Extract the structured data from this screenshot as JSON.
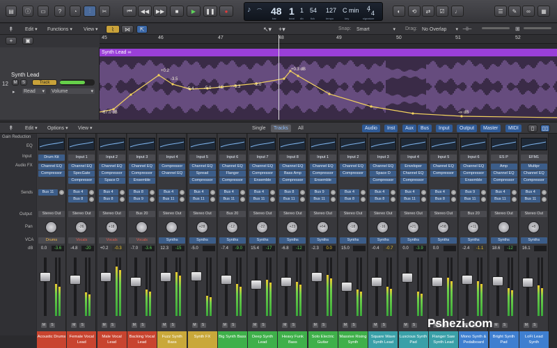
{
  "toolbar": {
    "lcd": {
      "bar": "48",
      "beat": "1",
      "div": "1",
      "tick": "54",
      "tempo": "127",
      "key": "C min",
      "sig_top": "4",
      "sig_bottom": "4",
      "cap_bar": "bar",
      "cap_beat": "beat",
      "cap_div": "div",
      "cap_tick": "tick",
      "cap_tempo": "tempo",
      "cap_key": "key",
      "cap_sig": "signature"
    }
  },
  "editbar": {
    "edit": "Edit",
    "functions": "Functions",
    "view": "View",
    "snap_label": "Snap:",
    "snap_value": "Smart",
    "drag_label": "Drag:",
    "drag_value": "No Overlap"
  },
  "ruler": {
    "bars": [
      "45",
      "46",
      "47",
      "48",
      "49",
      "50",
      "51",
      "52"
    ]
  },
  "track": {
    "number": "12",
    "name": "Synth Lead",
    "m": "M",
    "s": "S",
    "track_btn": "Track",
    "mode": "Read",
    "param": "Volume",
    "region_name": "Synth Lead",
    "automation_labels": [
      "+0.2",
      "-3.5",
      "-5.4",
      "-5.0",
      "-4.3",
      "-3.3",
      "-2.0",
      "+0.3 dB",
      "-67.0 dB",
      "-∞ dB"
    ]
  },
  "mixer": {
    "edit": "Edit",
    "options": "Options",
    "view": "View",
    "view_tabs": [
      "Single",
      "Tracks",
      "All"
    ],
    "filter_tabs": [
      "Audio",
      "Inst",
      "Aux",
      "Bus",
      "Input",
      "Output",
      "Master",
      "MIDI"
    ],
    "row_labels": {
      "gain": "Gain Reduction",
      "eq": "EQ",
      "input": "Input",
      "fx": "Audio FX",
      "sends": "Sends",
      "output": "Output",
      "pan": "Pan",
      "vca": "VCA",
      "db": "dB"
    },
    "strips": [
      {
        "input": "Drum Kit",
        "fx": [
          "Channel EQ",
          "Compressor"
        ],
        "sends": [
          "Bus 11"
        ],
        "output": "Stereo Out",
        "pan": "",
        "vca": "Drums",
        "db1": "0.0",
        "db2": "-3.6",
        "name": "Acoustic Drums",
        "color": "#c8442f"
      },
      {
        "input": "Input 1",
        "fx": [
          "Channel EQ",
          "SpecGate",
          "Compressor"
        ],
        "sends": [
          "Bus 4",
          "Bus 8"
        ],
        "output": "Stereo Out",
        "pan": "-26",
        "vca": "Vocals",
        "db1": "-4.8",
        "db2": "-20",
        "name": "Female Vocal Lead",
        "color": "#c8442f"
      },
      {
        "input": "Input 2",
        "fx": [
          "Channel EQ",
          "Compressor",
          "Space D"
        ],
        "sends": [
          "Bus 4",
          "Bus 8"
        ],
        "output": "Stereo Out",
        "pan": "+18",
        "vca": "Vocals",
        "db1": "+0.2",
        "db2": "-0.3",
        "name": "Male Vocal Lead",
        "color": "#c8442f"
      },
      {
        "input": "Input 3",
        "fx": [
          "Channel EQ",
          "Compressor",
          "Ensemble"
        ],
        "sends": [
          "Bus 8",
          "Bus 9"
        ],
        "output": "Bus 20",
        "pan": "",
        "vca": "Vocals",
        "db1": "-7.0",
        "db2": "-3.6",
        "name": "Backing Vocal Lead",
        "color": "#c8442f"
      },
      {
        "input": "Input 4",
        "fx": [
          "Compressor",
          "Channel EQ"
        ],
        "sends": [
          "Bus 4",
          "Bus 11"
        ],
        "output": "Stereo Out",
        "pan": "",
        "vca": "Synths",
        "db1": "12.3",
        "db2": "-15",
        "name": "Fuzz Synth Bass",
        "color": "#c9a83a"
      },
      {
        "input": "Input 5",
        "fx": [
          "Channel EQ",
          "Spread",
          "Compressor"
        ],
        "sends": [
          "Bus 4",
          "Bus 11"
        ],
        "output": "Stereo Out",
        "pan": "+28",
        "vca": "Synths",
        "db1": "-5.0",
        "db2": "",
        "name": "Synth FX",
        "color": "#c9a83a"
      },
      {
        "input": "Input 6",
        "fx": [
          "Channel EQ",
          "Flanger",
          "Compressor"
        ],
        "sends": [
          "Bus 4",
          "Bus 11"
        ],
        "output": "Bus 20",
        "pan": "-12",
        "vca": "Synths",
        "db1": "-7.4",
        "db2": "-9.0",
        "name": "Big Synth Bass",
        "color": "#3fb04a"
      },
      {
        "input": "Input 7",
        "fx": [
          "Channel EQ",
          "Compressor",
          "Ensemble"
        ],
        "sends": [
          "Bus 4",
          "Bus 11"
        ],
        "output": "Stereo Out",
        "pan": "-22",
        "vca": "Synths",
        "db1": "15.4",
        "db2": "-17",
        "name": "Deep Synth Lead",
        "color": "#3fb04a"
      },
      {
        "input": "Input 8",
        "fx": [
          "Channel EQ",
          "Bass Amp",
          "Compressor"
        ],
        "sends": [
          "Bus 8",
          "Bus 11"
        ],
        "output": "Stereo Out",
        "pan": "+23",
        "vca": "Synths",
        "db1": "-6.8",
        "db2": "-12",
        "name": "Heavy Funk Bass",
        "color": "#3fb04a"
      },
      {
        "input": "Input 1",
        "fx": [
          "Channel EQ",
          "Compressor",
          "Ensemble"
        ],
        "sends": [
          "Bus 9",
          "Bus 11"
        ],
        "output": "Stereo Out",
        "pan": "+64",
        "vca": "Synths",
        "db1": "-2.3",
        "db2": "0.0",
        "name": "Solo Electric Guitar",
        "color": "#3fb04a"
      },
      {
        "input": "Input 2",
        "fx": [
          "Channel EQ",
          "Compressor"
        ],
        "sends": [
          "Bus 4",
          "Bus 8"
        ],
        "output": "Stereo Out",
        "pan": "-18",
        "vca": "Synths",
        "db1": "15.0",
        "db2": "",
        "name": "Massive Rising Synth",
        "color": "#3fb04a"
      },
      {
        "input": "Input 3",
        "fx": [
          "Channel EQ",
          "Space D",
          "Compressor"
        ],
        "sends": [
          "Bus 4",
          "Bus 8"
        ],
        "output": "Stereo Out",
        "pan": "-16",
        "vca": "Synths",
        "db1": "-0.4",
        "db2": "-0.7",
        "name": "Square Wave Synth Lead",
        "color": "#3aa0a8"
      },
      {
        "input": "Input 4",
        "fx": [
          "Enveloper",
          "Channel EQ",
          "Compressor"
        ],
        "sends": [
          "Bus 4",
          "Bus 11"
        ],
        "output": "Stereo Out",
        "pan": "+21",
        "vca": "Synths",
        "db1": "0.0",
        "db2": "-3.9",
        "name": "Luscious Synth Pad",
        "color": "#3aa0a8"
      },
      {
        "input": "Input 5",
        "fx": [
          "Channel EQ",
          "Compressor"
        ],
        "sends": [
          "Bus 4",
          "Bus 8"
        ],
        "output": "Stereo Out",
        "pan": "+58",
        "vca": "Synths",
        "db1": "0.0",
        "db2": "",
        "name": "Flanger Saw Synth Lead",
        "color": "#3aa0a8"
      },
      {
        "input": "Input 6",
        "fx": [
          "Channel EQ",
          "Compressor",
          "Ensemble"
        ],
        "sends": [
          "Bus 9",
          "Bus 11"
        ],
        "output": "Bus 20",
        "pan": "+11",
        "vca": "Synths",
        "db1": "-2.4",
        "db2": "-1.1",
        "name": "Mono Synth & Pedalboard",
        "color": "#3f7fd0"
      },
      {
        "input": "ES P",
        "fx": [
          "Amp",
          "Channel EQ",
          "Compressor"
        ],
        "sends": [
          "Bus 4",
          "Bus 11"
        ],
        "output": "Stereo Out",
        "pan": "",
        "vca": "Synths",
        "db1": "18.6",
        "db2": "-12",
        "name": "Bright Synth Pad",
        "color": "#3f7fd0"
      },
      {
        "input": "EFM1",
        "fx": [
          "Multipr",
          "Channel EQ",
          "Compressor"
        ],
        "sends": [
          "Bus 4",
          "Bus 11"
        ],
        "output": "Stereo Out",
        "pan": "+8",
        "vca": "Synths",
        "db1": "16.1",
        "db2": "",
        "name": "LoFi Lead Synth",
        "color": "#3f7fd0"
      }
    ],
    "levels": [
      0.55,
      0.4,
      0.85,
      0.45,
      0.75,
      0.35,
      0.55,
      0.62,
      0.58,
      0.7,
      0.45,
      0.5,
      0.42,
      0.65,
      0.6,
      0.48,
      0.52
    ],
    "fader_pos": [
      0.3,
      0.35,
      0.3,
      0.4,
      0.3,
      0.28,
      0.35,
      0.45,
      0.4,
      0.3,
      0.5,
      0.4,
      0.32,
      0.4,
      0.36,
      0.38,
      0.42
    ]
  },
  "watermark": "Pshezi.com"
}
